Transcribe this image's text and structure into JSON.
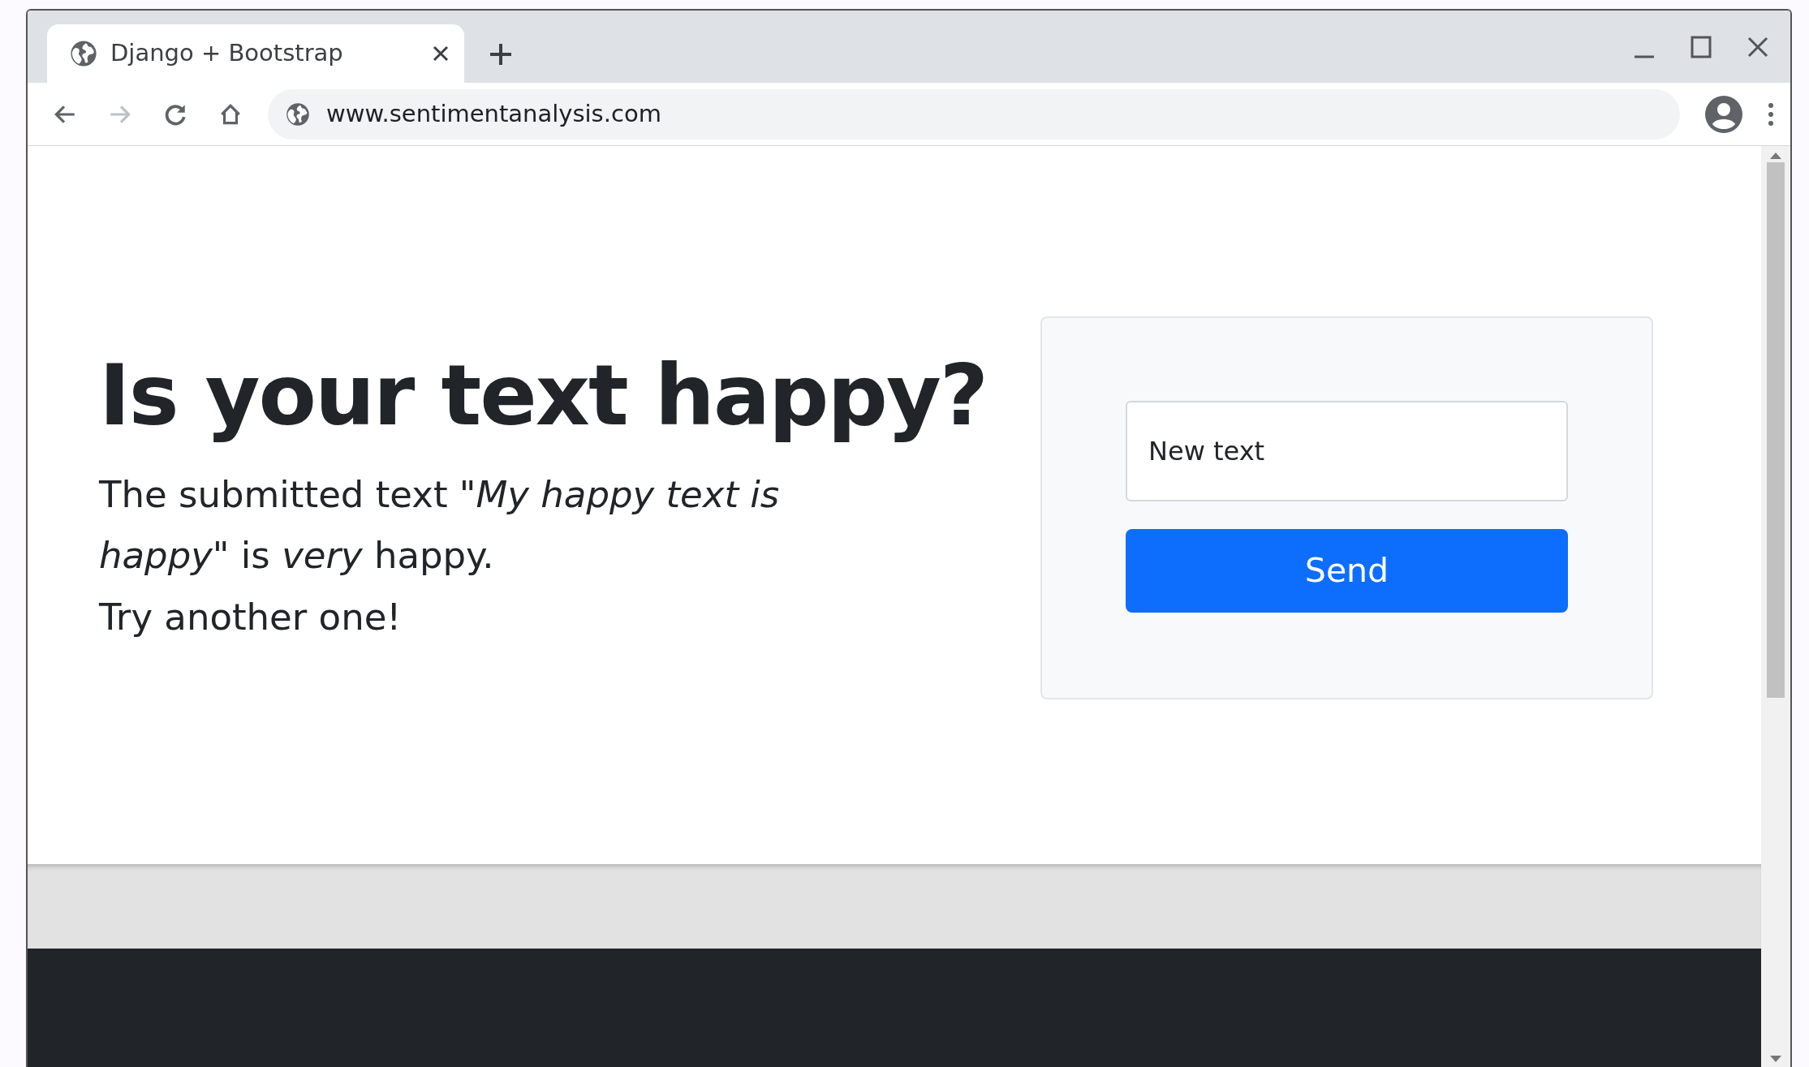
{
  "browser": {
    "tab": {
      "title": "Django + Bootstrap"
    },
    "nav": [
      {
        "kind": "back",
        "disabled": false
      },
      {
        "kind": "forward",
        "disabled": true
      },
      {
        "kind": "reload",
        "disabled": false
      },
      {
        "kind": "home",
        "disabled": false
      }
    ],
    "address": "www.sentimentanalysis.com"
  },
  "hero": {
    "heading": "Is your text happy?",
    "result": "The submitted text *\"My happy text is happy\"* is *very* happy.",
    "prompt": "Try another one!"
  },
  "form": {
    "placeholder": "New text",
    "button": "Send"
  }
}
